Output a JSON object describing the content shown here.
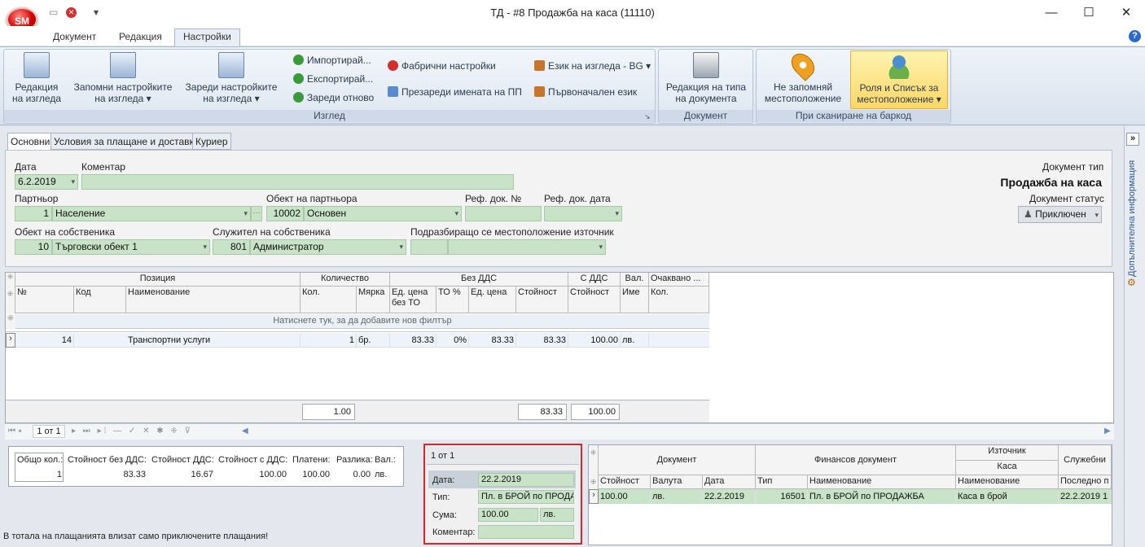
{
  "window": {
    "title": "ТД - #8 Продажба на каса (11110)",
    "logo_text": "SM",
    "min_glyph": "—",
    "max_glyph": "☐",
    "close_glyph": "✕",
    "qat_arrow": "▾"
  },
  "ribbon_tabs": [
    "Документ",
    "Редакция",
    "Настройки"
  ],
  "help_glyph": "?",
  "ribbon": {
    "view_group": {
      "label": "Изглед",
      "edit_view": [
        "Редакция",
        "на изгледа"
      ],
      "save_settings": [
        "Запомни настройките",
        "на изгледа ▾"
      ],
      "load_settings": [
        "Зареди настройките",
        "на изгледа ▾"
      ],
      "import": "Импортирай...",
      "export": "Експортирай...",
      "reload": "Зареди отново",
      "factory": "Фабрични настройки",
      "reload_names": "Презареди имената на ПП",
      "language": "Език на изгледа - BG",
      "initial_language": "Първоначален език"
    },
    "document_group": {
      "label": "Документ",
      "edit_type": [
        "Редакция на типа",
        "на документа"
      ]
    },
    "barcode_group": {
      "label": "При сканиране на баркод",
      "no_location": [
        "Не запомняй",
        "местоположение"
      ],
      "role_list": [
        "Роля и Списък за",
        "местоположение ▾"
      ]
    }
  },
  "form_tabs": [
    "Основни",
    "Условия за плащане и доставка",
    "Куриер"
  ],
  "form": {
    "date_label": "Дата",
    "date_value": "6.2.2019",
    "comment_label": "Коментар",
    "comment_value": "",
    "doc_type_label": "Документ тип",
    "doc_type_value": "Продажба на каса",
    "partner_label": "Партньор",
    "partner_id": "1",
    "partner_name": "Население",
    "partner_obj_label": "Обект на партньора",
    "partner_obj_id": "10002",
    "partner_obj_name": "Основен",
    "ref_doc_label": "Реф. док. №",
    "ref_date_label": "Реф. док. дата",
    "doc_status_label": "Документ статус",
    "doc_status_value": "Приключен",
    "owner_obj_label": "Обект на собственика",
    "owner_obj_id": "10",
    "owner_obj_name": "Търговски обект 1",
    "employee_label": "Служител на собственика",
    "employee_id": "801",
    "employee_name": "Администратор",
    "default_loc_label": "Подразбиращо се местоположение източник"
  },
  "items_grid": {
    "group_headers": [
      "Позиция",
      "Количество",
      "Без ДДС",
      "С ДДС",
      "Вал.",
      "Очаквано ..."
    ],
    "columns": [
      "№",
      "Код",
      "Наименование",
      "Кол.",
      "Мярка",
      "Ед. цена без ТО",
      "ТО %",
      "Ед. цена",
      "Стойност",
      "Стойност",
      "Име",
      "Кол."
    ],
    "filter_hint": "Натиснете тук, за да добавите нов филтър",
    "rows": [
      [
        "14",
        "",
        "Транспортни услуги",
        "1",
        "бр.",
        "83.33",
        "0%",
        "83.33",
        "83.33",
        "100.00",
        "лв.",
        ""
      ]
    ],
    "totals": {
      "qty": "1.00",
      "value_net": "83.33",
      "value_gross": "100.00"
    },
    "pager": "1 от 1"
  },
  "summary": {
    "headers": [
      "Общо кол.:",
      "Стойност без ДДС:",
      "Стойност ДДС:",
      "Стойност с ДДС:",
      "Платени:",
      "Разлика:",
      "Вал.:"
    ],
    "values": [
      "1",
      "83.33",
      "16.67",
      "100.00",
      "100.00",
      "0.00",
      "лв."
    ],
    "note": "В тотала на плащанията влизат само приключените плащания!"
  },
  "payment": {
    "pager": "1 от 1",
    "date_label": "Дата:",
    "date_value": "22.2.2019",
    "type_label": "Тип:",
    "type_value": "Пл. в БРОЙ по ПРОДАЖБА",
    "amount_label": "Сума:",
    "amount_value": "100.00",
    "currency": "лв.",
    "comment_label": "Коментар:",
    "comment_value": ""
  },
  "payments_grid": {
    "group_headers": [
      "Документ",
      "Финансов документ",
      "Източник",
      "Каса",
      "Служебни"
    ],
    "columns": [
      "Стойност",
      "Валута",
      "Дата",
      "Тип",
      "Наименование",
      "Наименование",
      "Последно п"
    ],
    "rows": [
      [
        "100.00",
        "лв.",
        "22.2.2019",
        "16501",
        "Пл. в БРОЙ по ПРОДАЖБА",
        "Каса в брой",
        "22.2.2019 1"
      ]
    ]
  },
  "side_panel": {
    "label": "Допълнителна информация",
    "toggle": "»"
  }
}
